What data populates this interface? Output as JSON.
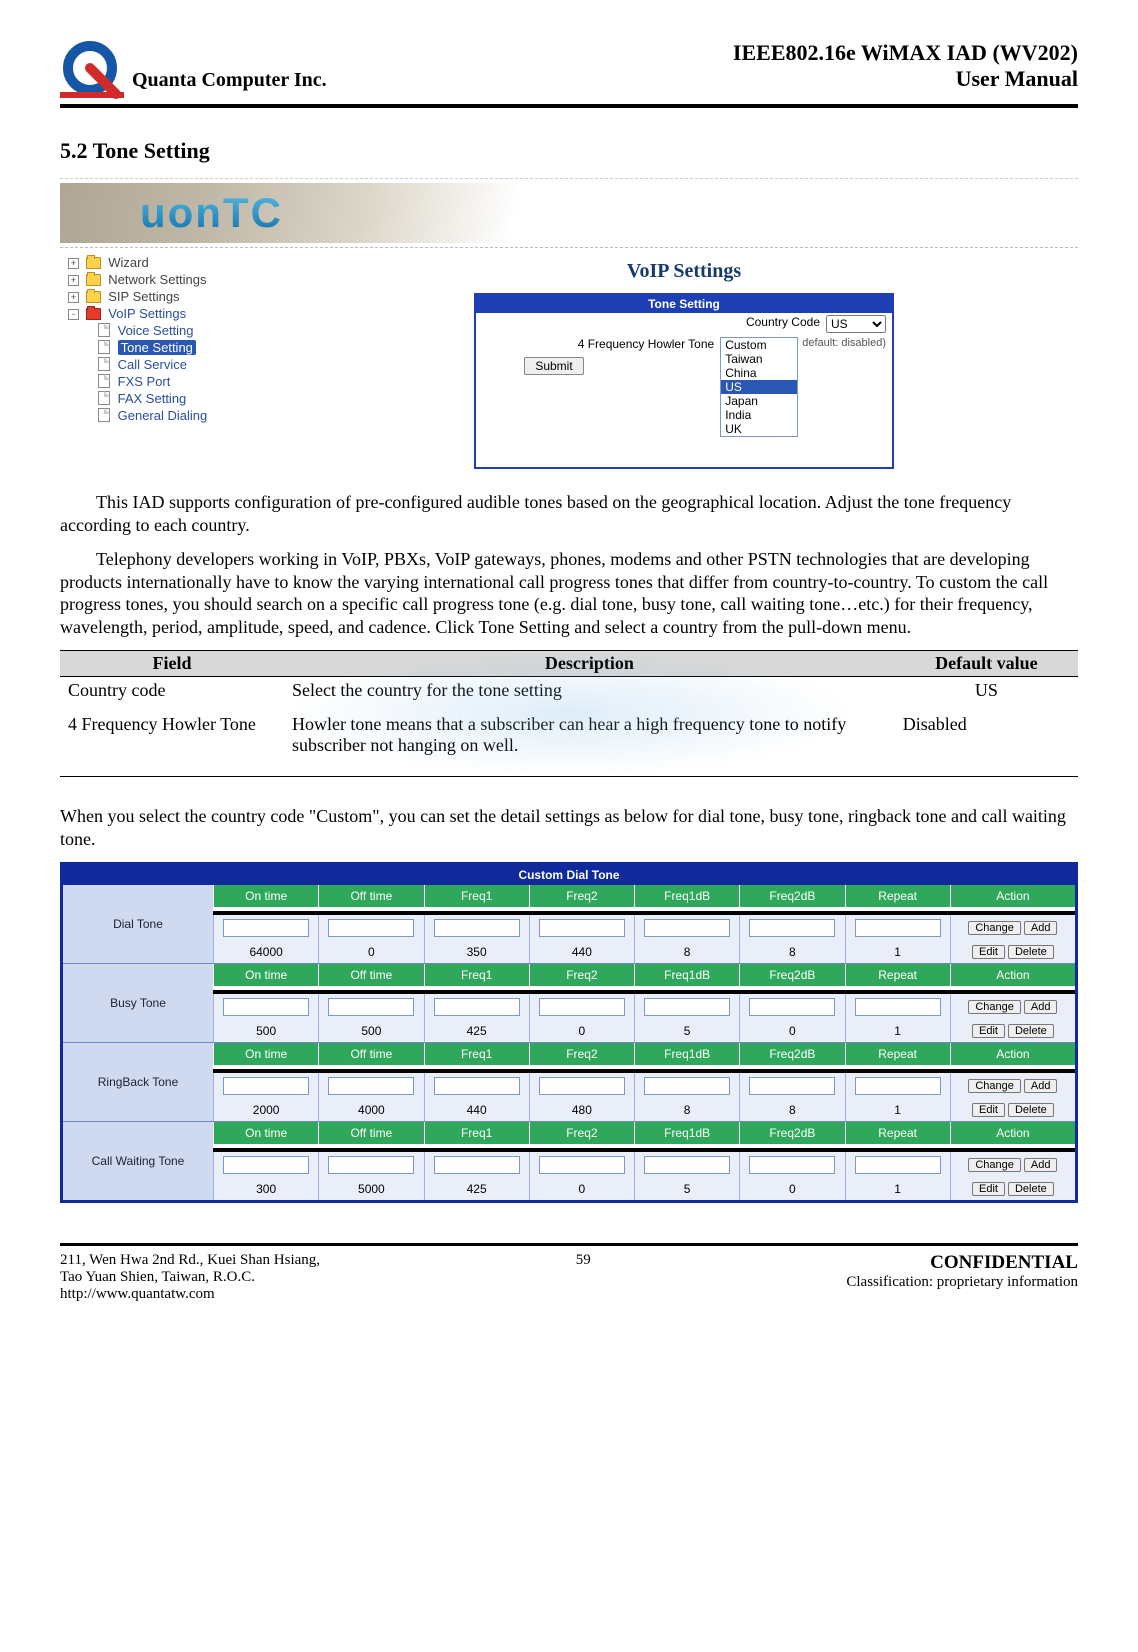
{
  "header": {
    "company": "Quanta  Computer  Inc.",
    "title_line1": "IEEE802.16e  WiMAX  IAD  (WV202)",
    "title_line2": "User  Manual"
  },
  "section_heading": "5.2  Tone Setting",
  "banner_text": "uonTC",
  "nav": {
    "wizard": "Wizard",
    "network": "Network Settings",
    "sip": "SIP Settings",
    "voip": "VoIP Settings",
    "voice_setting": "Voice Setting",
    "tone_setting": "Tone Setting",
    "call_service": "Call Service",
    "fxs_port": "FXS Port",
    "fax_setting": "FAX Setting",
    "general_dialing": "General Dialing"
  },
  "voip": {
    "title": "VoIP Settings",
    "tone_setting": "Tone Setting",
    "country_code_label": "Country Code",
    "country_code_value": "US",
    "howler_label": "4 Frequency Howler Tone",
    "howler_note": "default: disabled)",
    "submit_label": "Submit",
    "options": {
      "custom": "Custom",
      "taiwan": "Taiwan",
      "china": "China",
      "us": "US",
      "japan": "Japan",
      "india": "India",
      "uk": "UK"
    }
  },
  "para1": "This IAD supports configuration of pre-configured audible tones based on the geographical location. Adjust the tone frequency according to each country.",
  "para2": "Telephony developers working in VoIP, PBXs, VoIP gateways, phones, modems and other PSTN technologies that are developing products internationally have to know the varying international call progress tones that differ from country-to-country. To custom the call progress tones, you should search on a specific call progress tone (e.g. dial tone, busy tone, call waiting tone…etc.) for their frequency, wavelength, period, amplitude, speed, and cadence. Click Tone Setting and select a country from the pull-down menu.",
  "ftable": {
    "h_field": "Field",
    "h_desc": "Description",
    "h_def": "Default value",
    "r1_field": "Country code",
    "r1_desc": "Select the country for the tone setting",
    "r1_def": "US",
    "r2_field": "4 Frequency Howler Tone",
    "r2_desc": "Howler tone means that a subscriber can hear a high frequency tone to notify subscriber not hanging on well.",
    "r2_def": "Disabled"
  },
  "para3": "When you select the country code \"Custom\", you can set the detail settings as below for dial tone, busy tone, ringback tone and call waiting tone.",
  "cdt": {
    "title": "Custom Dial Tone",
    "cols": {
      "ontime": "On time",
      "offtime": "Off time",
      "freq1": "Freq1",
      "freq2": "Freq2",
      "freq1db": "Freq1dB",
      "freq2db": "Freq2dB",
      "repeat": "Repeat",
      "action": "Action"
    },
    "btn_change": "Change",
    "btn_add": "Add",
    "btn_edit": "Edit",
    "btn_delete": "Delete",
    "rows": [
      {
        "name": "Dial Tone",
        "v": [
          "64000",
          "0",
          "350",
          "440",
          "8",
          "8",
          "1"
        ]
      },
      {
        "name": "Busy Tone",
        "v": [
          "500",
          "500",
          "425",
          "0",
          "5",
          "0",
          "1"
        ]
      },
      {
        "name": "RingBack Tone",
        "v": [
          "2000",
          "4000",
          "440",
          "480",
          "8",
          "8",
          "1"
        ]
      },
      {
        "name": "Call Waiting Tone",
        "v": [
          "300",
          "5000",
          "425",
          "0",
          "5",
          "0",
          "1"
        ]
      }
    ]
  },
  "footer": {
    "addr1": "211, Wen Hwa 2nd Rd., Kuei Shan Hsiang,",
    "addr2": "Tao Yuan Shien, Taiwan, R.O.C.",
    "addr3": "http://www.quantatw.com",
    "page": "59",
    "conf": "CONFIDENTIAL",
    "class": "Classification: proprietary information"
  }
}
